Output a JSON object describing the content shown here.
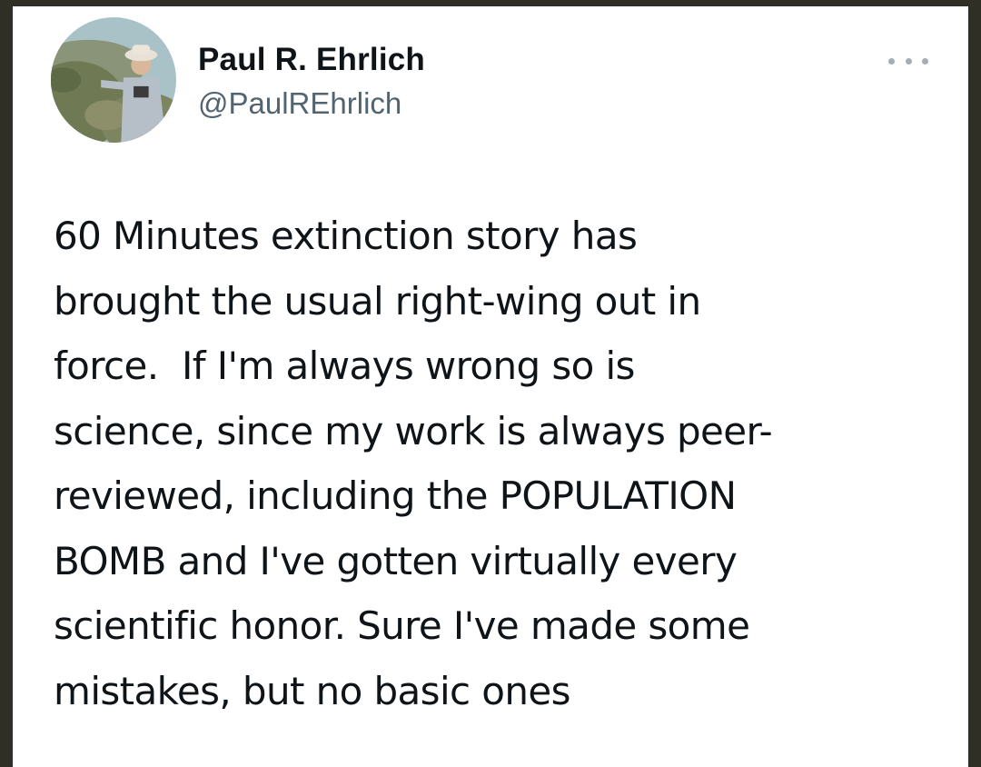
{
  "tweet": {
    "author": {
      "display_name": "Paul R. Ehrlich",
      "handle": "@PaulREhrlich"
    },
    "more_icon": "more-dots-icon",
    "text_lines": [
      "60 Minutes extinction story has",
      "brought the usual right-wing out in",
      "force.  If I'm always wrong so is",
      "science, since my work is always peer-",
      "reviewed, including the POPULATION",
      "BOMB and I've gotten virtually every",
      "scientific honor. Sure I've made some",
      "mistakes, but no basic ones"
    ]
  },
  "colors": {
    "background": "#2f2f25",
    "card": "#ffffff",
    "name_text": "#0f1419",
    "handle_text": "#536471",
    "icon_gray": "#a6aeb5"
  }
}
